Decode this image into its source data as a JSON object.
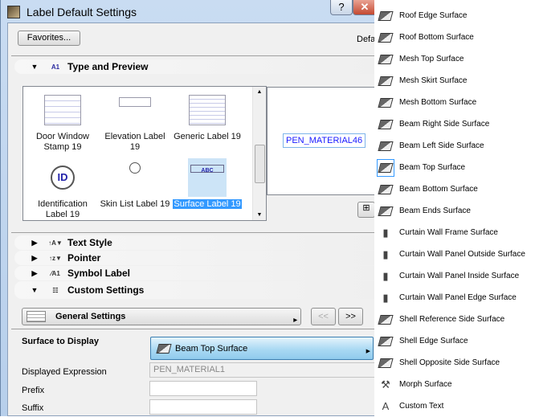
{
  "window": {
    "title": "Label Default Settings",
    "help": "?",
    "close": "✕"
  },
  "toolbar": {
    "favorites": "Favorites...",
    "default_partial": "Defa"
  },
  "sections": {
    "type_preview": "Type and Preview",
    "text_style": "Text Style",
    "pointer": "Pointer",
    "symbol_label": "Symbol Label",
    "custom_settings": "Custom Settings"
  },
  "gallery": [
    {
      "label": "Door Window Stamp 19"
    },
    {
      "label": "Elevation Label 19"
    },
    {
      "label": "Generic Label 19"
    },
    {
      "label": "Identification Label 19"
    },
    {
      "label": "Skin List Label 19"
    },
    {
      "label": "Surface Label 19",
      "selected": true
    }
  ],
  "preview": {
    "text": "PEN_MATERIAL46"
  },
  "custom": {
    "page": "General Settings",
    "prev": "<<",
    "next": ">>",
    "surface_label": "Surface to Display",
    "surface_value": "Beam Top Surface",
    "expr_label": "Displayed Expression",
    "expr_value": "PEN_MATERIAL1",
    "prefix_label": "Prefix",
    "prefix_value": "",
    "suffix_label": "Suffix",
    "suffix_value": ""
  },
  "menu": [
    "Roof Edge Surface",
    "Roof Bottom Surface",
    "Mesh Top Surface",
    "Mesh Skirt Surface",
    "Mesh Bottom Surface",
    "Beam Right Side Surface",
    "Beam Left Side Surface",
    "Beam Top Surface",
    "Beam Bottom Surface",
    "Beam Ends Surface",
    "Curtain Wall Frame Surface",
    "Curtain Wall Panel Outside Surface",
    "Curtain Wall Panel Inside Surface",
    "Curtain Wall Panel Edge Surface",
    "Shell Reference Side Surface",
    "Shell Edge Surface",
    "Shell Opposite Side Surface",
    "Morph Surface",
    "Custom Text"
  ],
  "menu_selected": "Beam Top Surface",
  "colors": {
    "selection": "#3399ff",
    "preview_text": "#1a1aff"
  }
}
